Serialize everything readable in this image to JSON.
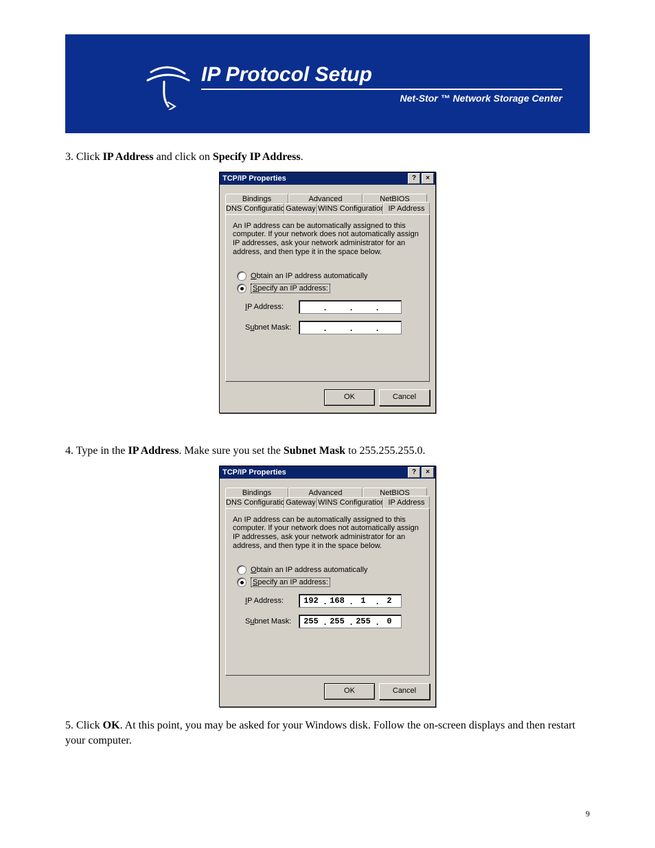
{
  "banner": {
    "title": "IP Protocol Setup",
    "subtitle": "Net-Stor ™ Network Storage Center"
  },
  "step3": {
    "prefix": "3. Click ",
    "bold1": "IP Address",
    "mid": " and click on ",
    "bold2": "Specify IP Address",
    "suffix": "."
  },
  "step4": {
    "prefix": "4. Type in the ",
    "bold1": "IP Address",
    "mid": ". Make sure you set the ",
    "bold2": "Subnet Mask",
    "suffix": " to 255.255.255.0."
  },
  "step5": {
    "prefix": "5. Click ",
    "bold1": "OK",
    "suffix": ".  At this point, you may be asked for your Windows disk.  Follow the on-screen displays and then restart your computer."
  },
  "dialog": {
    "title": "TCP/IP Properties",
    "tabs_row1": [
      "Bindings",
      "Advanced",
      "NetBIOS"
    ],
    "tabs_row2": [
      "DNS Configuration",
      "Gateway",
      "WINS Configuration",
      "IP Address"
    ],
    "desc": "An IP address can be automatically assigned to this computer. If your network does not automatically assign IP addresses, ask your network administrator for an address, and then type it in the space below.",
    "radio1_u": "O",
    "radio1_rest": "btain an IP address automatically",
    "radio2_u": "S",
    "radio2_rest": "pecify an IP address:",
    "label_ip_u": "I",
    "label_ip_rest": "P Address:",
    "label_sm_pre": "S",
    "label_sm_u": "u",
    "label_sm_rest": "bnet Mask:",
    "ok": "OK",
    "cancel": "Cancel"
  },
  "values2": {
    "ip": [
      "192",
      "168",
      "1",
      "2"
    ],
    "mask": [
      "255",
      "255",
      "255",
      "0"
    ]
  },
  "pagenum": "9"
}
